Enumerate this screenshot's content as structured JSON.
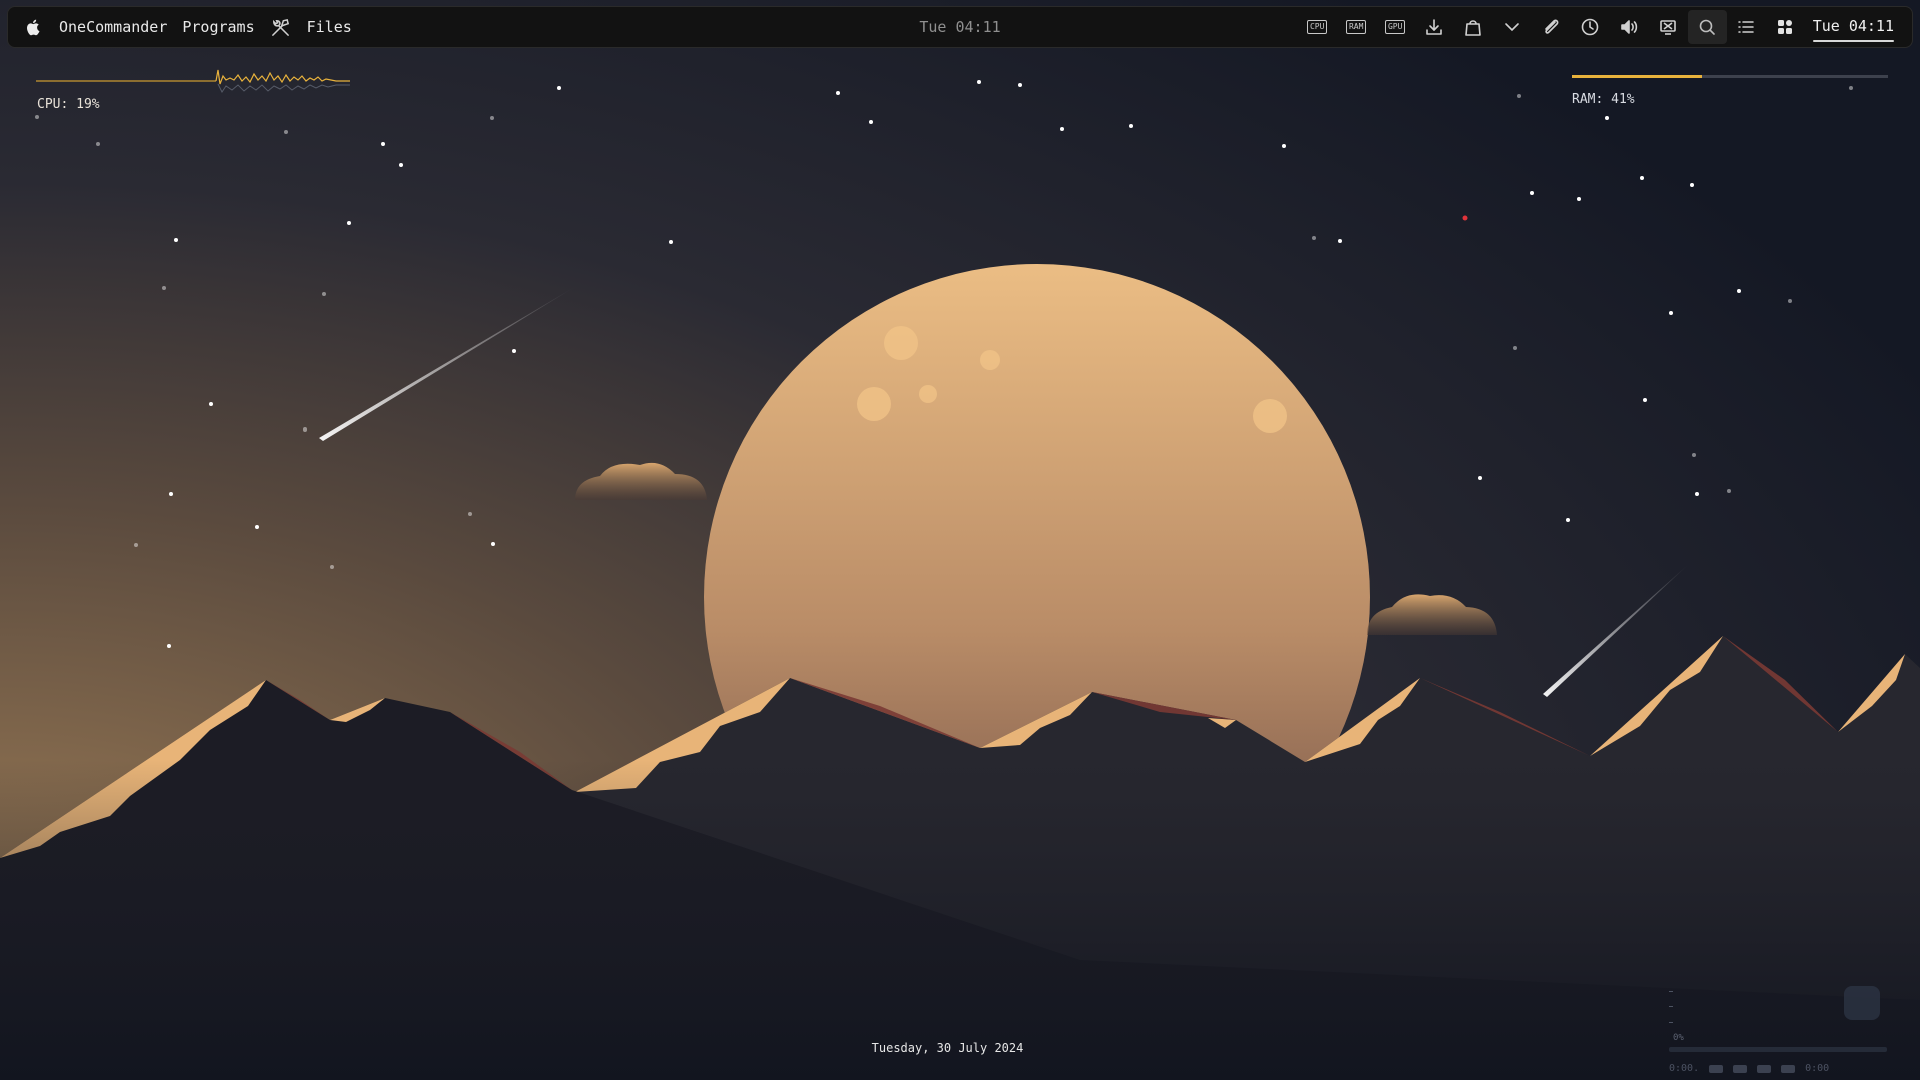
{
  "menubar": {
    "apple_icon": "apple-icon",
    "items": [
      "OneCommander",
      "Programs",
      "Files"
    ],
    "tools_icon": "tools-icon",
    "center_clock": "Tue 04:11",
    "tray": [
      {
        "name": "cpu-monitor-icon",
        "chip": "CPU"
      },
      {
        "name": "ram-monitor-icon",
        "chip": "RAM"
      },
      {
        "name": "gpu-monitor-icon",
        "chip": "GPU"
      },
      {
        "name": "download-icon"
      },
      {
        "name": "shopping-bag-icon"
      },
      {
        "name": "chevron-down-icon"
      },
      {
        "name": "paperclip-icon"
      },
      {
        "name": "clock-icon"
      },
      {
        "name": "volume-icon"
      },
      {
        "name": "display-icon"
      },
      {
        "name": "search-icon"
      },
      {
        "name": "list-icon"
      },
      {
        "name": "widgets-icon"
      }
    ],
    "right_clock": "Tue 04:11"
  },
  "widgets": {
    "cpu_label": "CPU: 19%",
    "cpu_percent": 19,
    "ram_label": "RAM: 41%",
    "ram_percent": 41,
    "date": "Tuesday, 30  July  2024",
    "accent": "#e8b23c"
  },
  "dock": {
    "percent": "0%",
    "readout": "0:00.",
    "readout_end": "0:00"
  },
  "colors": {
    "sky_warm": "#927452",
    "sky_dark": "#141824",
    "moon_top": "#e8bb82",
    "moon_bottom": "#7e5b4a",
    "peak_light": "#e8b478",
    "peak_red": "#7a3a34",
    "mountain_dark": "#1e1e26"
  }
}
